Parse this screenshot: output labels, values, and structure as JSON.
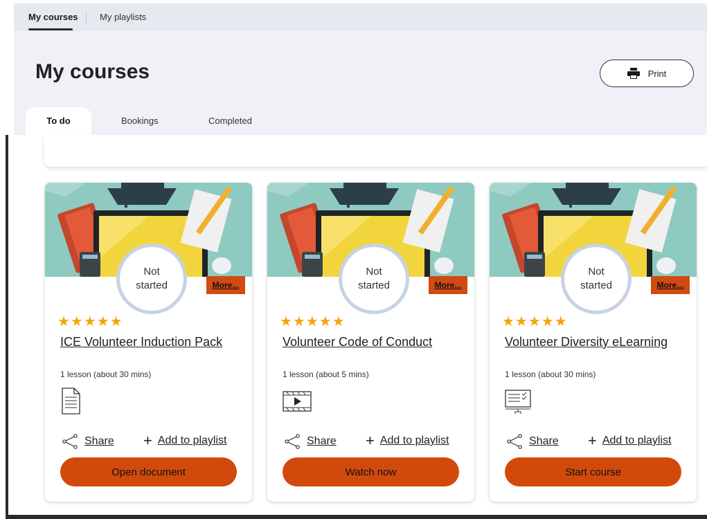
{
  "top_nav": {
    "tabs": [
      {
        "label": "My courses",
        "active": true
      },
      {
        "label": "My playlists",
        "active": false
      }
    ]
  },
  "header": {
    "title": "My courses",
    "print_label": "Print"
  },
  "sub_tabs": [
    {
      "label": "To do",
      "active": true
    },
    {
      "label": "Bookings",
      "active": false
    },
    {
      "label": "Completed",
      "active": false
    }
  ],
  "colors": {
    "accent": "#d14a0c",
    "star": "#f2a60c",
    "header_bg": "#eff1f6",
    "nav_bg": "#e6e9f0"
  },
  "cards": [
    {
      "status_line1": "Not",
      "status_line2": "started",
      "more_label": "More...",
      "rating": 5,
      "stars": "★★★★★",
      "title": "ICE Volunteer Induction Pack",
      "lesson_info": "1 lesson (about 30 mins)",
      "type_icon": "document-icon",
      "share_label": "Share",
      "playlist_label": "Add to playlist",
      "action_label": "Open document"
    },
    {
      "status_line1": "Not",
      "status_line2": "started",
      "more_label": "More...",
      "rating": 5,
      "stars": "★★★★★",
      "title": "Volunteer Code of Conduct",
      "lesson_info": "1 lesson (about 5 mins)",
      "type_icon": "video-icon",
      "share_label": "Share",
      "playlist_label": "Add to playlist",
      "action_label": "Watch now"
    },
    {
      "status_line1": "Not",
      "status_line2": "started",
      "more_label": "More...",
      "rating": 5,
      "stars": "★★★★★",
      "title": "Volunteer Diversity eLearning",
      "lesson_info": "1 lesson (about 30 mins)",
      "type_icon": "elearning-icon",
      "share_label": "Share",
      "playlist_label": "Add to playlist",
      "action_label": "Start course"
    }
  ]
}
